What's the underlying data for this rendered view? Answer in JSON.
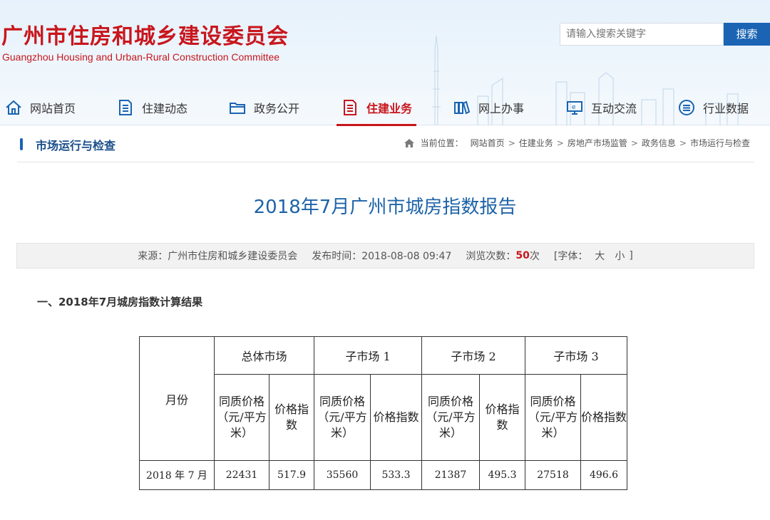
{
  "header": {
    "title": "广州市住房和城乡建设委员会",
    "subtitle": "Guangzhou Housing and Urban-Rural Construction Committee",
    "search": {
      "placeholder": "请输入搜索关键字",
      "button": "搜索"
    }
  },
  "nav": {
    "items": [
      {
        "label": "网站首页",
        "icon": "home-icon"
      },
      {
        "label": "住建动态",
        "icon": "document-icon"
      },
      {
        "label": "政务公开",
        "icon": "folder-icon"
      },
      {
        "label": "住建业务",
        "icon": "document-icon",
        "active": true
      },
      {
        "label": "网上办事",
        "icon": "books-icon"
      },
      {
        "label": "互动交流",
        "icon": "monitor-icon"
      },
      {
        "label": "行业数据",
        "icon": "list-circle-icon"
      }
    ]
  },
  "section": {
    "title": "市场运行与检查",
    "breadcrumb": {
      "prefix": "当前位置：",
      "items": [
        "网站首页",
        "住建业务",
        "房地产市场监管",
        "政务信息",
        "市场运行与检查"
      ],
      "separator": ">"
    }
  },
  "article": {
    "title": "2018年7月广州市城房指数报告",
    "meta": {
      "source": "来源：广州市住房和城乡建设委员会",
      "published": "发布时间：2018-08-08 09:47",
      "views_label": "浏览次数：",
      "views": "50",
      "views_suffix": "次",
      "font_label": "[字体：",
      "font_large": "大",
      "font_small": "小",
      "font_close": "]"
    },
    "subheading": "一、2018年7月城房指数计算结果"
  },
  "table": {
    "month_header": "月份",
    "groups": [
      "总体市场",
      "子市场 1",
      "子市场 2",
      "子市场 3"
    ],
    "price_header": "同质价格（元/平方米）",
    "index_header": "价格指数",
    "rows": [
      {
        "month": "2018 年 7 月",
        "values": [
          "22431",
          "517.9",
          "35560",
          "533.3",
          "21387",
          "495.3",
          "27518",
          "496.6"
        ]
      }
    ]
  },
  "colors": {
    "brand_red": "#c8161d",
    "link_blue": "#1d63a8",
    "button_blue": "#1a64b3"
  }
}
